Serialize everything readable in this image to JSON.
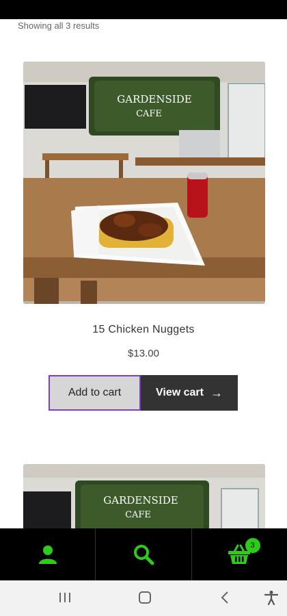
{
  "results": {
    "text": "Showing all 3 results"
  },
  "products": [
    {
      "title": "15 Chicken Nuggets",
      "price": "$13.00",
      "sign_line1": "GARDENSIDE",
      "sign_line2": "CAFE",
      "add_label": "Add to cart",
      "view_label": "View cart",
      "view_arrow": "→"
    },
    {
      "sign_line1": "GARDENSIDE",
      "sign_line2": "CAFE"
    }
  ],
  "bottom_nav": {
    "items": [
      {
        "icon": "user-icon"
      },
      {
        "icon": "search-icon"
      },
      {
        "icon": "basket-icon",
        "badge": "3"
      }
    ],
    "accent": "#2ecc1a"
  },
  "system_nav": {
    "items": [
      {
        "icon": "recent-apps-icon"
      },
      {
        "icon": "home-icon"
      },
      {
        "icon": "back-icon"
      },
      {
        "icon": "accessibility-icon"
      }
    ]
  }
}
